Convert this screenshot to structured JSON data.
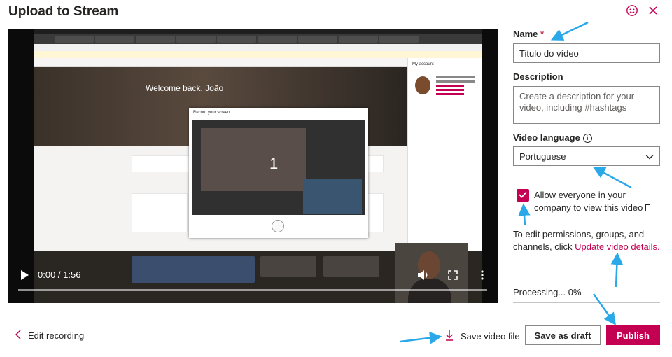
{
  "dialog": {
    "title": "Upload to Stream"
  },
  "player": {
    "time": "0:00 / 1:56",
    "progress": 0,
    "hero_greeting": "Welcome back, João",
    "record_dialog_title": "Record your screen",
    "countdown": "1",
    "account_panel_title": "My account"
  },
  "form": {
    "name_label": "Name",
    "name_required_mark": "*",
    "name_value": "Titulo do vídeo",
    "description_label": "Description",
    "description_placeholder": "Create a description for your video, including #hashtags",
    "language_label": "Video language",
    "language_value": "Portuguese",
    "allow_label": "Allow everyone in your company to view this video",
    "allow_checked": true,
    "permissions_text": "To edit permissions, groups, and channels, click",
    "permissions_link": "Update video details.",
    "processing": "Processing... 0%"
  },
  "footer": {
    "edit_recording": "Edit recording",
    "save_file": "Save video file",
    "save_draft": "Save as draft",
    "publish": "Publish"
  },
  "colors": {
    "accent": "#c30052",
    "annotation": "#2aa8e8"
  },
  "icons": [
    "smiley-icon",
    "close-icon",
    "play-icon",
    "volume-icon",
    "fullscreen-icon",
    "more-icon",
    "info-icon",
    "chevron-down-icon",
    "checkmark-icon",
    "chevron-left-icon",
    "download-icon"
  ]
}
